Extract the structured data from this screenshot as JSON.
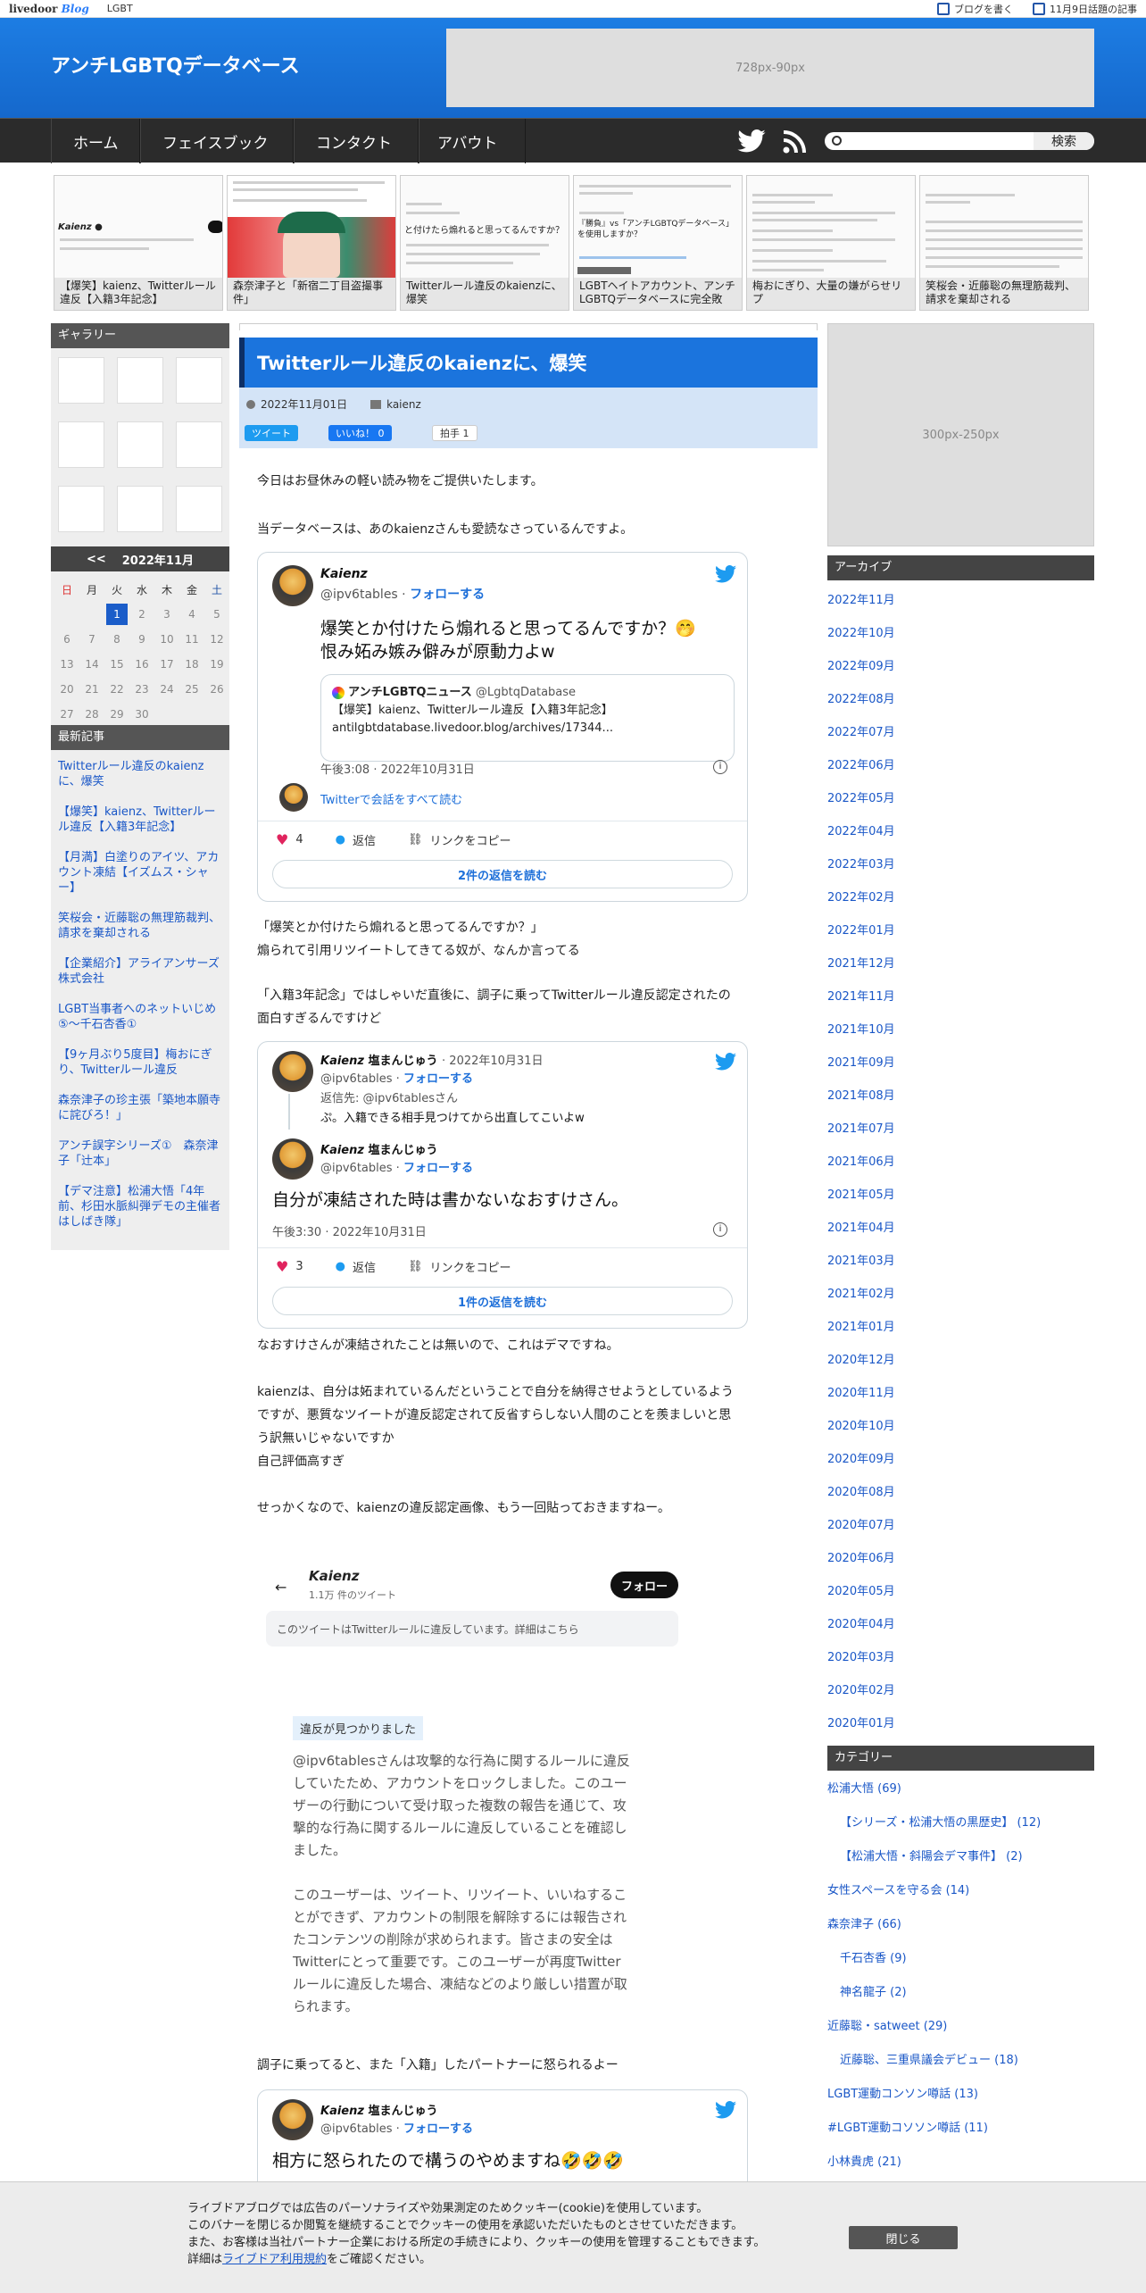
{
  "topbar": {
    "brand": "livedoor",
    "brand_sub": "Blog",
    "tag": "LGBT",
    "write": "ブログを書く",
    "trend": "11月9日話題の記事"
  },
  "header": {
    "title": "アンチLGBTQデータベース",
    "ad": "728px-90px"
  },
  "nav": {
    "items": [
      "ホーム",
      "フェイスブック",
      "コンタクト",
      "アバウト"
    ],
    "search_button": "検索"
  },
  "thumbs": [
    {
      "caption": "【爆笑】kaienz、Twitterルール違反【入籍3年記念】"
    },
    {
      "caption": "森奈津子と「新宿二丁目盗撮事件」"
    },
    {
      "caption": "Twitterルール違反のkaienzに、爆笑"
    },
    {
      "caption": "LGBTヘイトアカウント、アンチLGBTQデータベースに完全敗"
    },
    {
      "caption": "梅おにぎり、大量の嫌がらせリプ"
    },
    {
      "caption": "笑桜会・近藤聡の無理筋裁判、請求を棄却される"
    }
  ],
  "sidebar_left": {
    "gallery_title": "ギャラリー",
    "calendar": {
      "prev": "<<",
      "month": "2022年11月",
      "weekdays": [
        "日",
        "月",
        "火",
        "水",
        "木",
        "金",
        "土"
      ],
      "rows": [
        [
          "",
          "",
          "1",
          "2",
          "3",
          "4",
          "5"
        ],
        [
          "6",
          "7",
          "8",
          "9",
          "10",
          "11",
          "12"
        ],
        [
          "13",
          "14",
          "15",
          "16",
          "17",
          "18",
          "19"
        ],
        [
          "20",
          "21",
          "22",
          "23",
          "24",
          "25",
          "26"
        ],
        [
          "27",
          "28",
          "29",
          "30",
          "",
          "",
          ""
        ]
      ],
      "today": "1"
    },
    "recent_title": "最新記事",
    "recent": [
      "Twitterルール違反のkaienzに、爆笑",
      "【爆笑】kaienz、Twitterルール違反【入籍3年記念】",
      "【月満】白塗りのアイツ、アカウント凍結【イズムス・シャー】",
      "笑桜会・近藤聡の無理筋裁判、請求を棄却される",
      "【企業紹介】アライアンサーズ株式会社",
      "LGBT当事者へのネットいじめ⑤～千石杏香①",
      "【9ヶ月ぶり5度目】梅おにぎり、Twitterルール違反",
      "森奈津子の珍主張「築地本願寺に詫びろ！」",
      "アンチ誤字シリーズ①　森奈津子「辻本」",
      "【デマ注意】松浦大悟「4年前、杉田水脈糾弾デモの主催者はしばき隊」"
    ]
  },
  "post": {
    "title": "Twitterルール違反のkaienzに、爆笑",
    "date": "2022年11月01日",
    "category": "kaienz",
    "tweet_btn": "ツイート",
    "like_btn": "いいね！ 0",
    "clap_btn": "拍手 1",
    "p1": "今日はお昼休みの軽い読み物をご提供いたします。",
    "p2": "当データベースは、あのkaienzさんも愛読なさっているんですよ。",
    "tw1": {
      "name": "Kaienz",
      "handle": "@ipv6tables",
      "follow": "フォローする",
      "text1": "爆笑とか付けたら煽れると思ってるんですか？🤭",
      "text2": "恨み妬み嫉み僻みが原動力よw",
      "embed_name": "アンチLGBTQニュース",
      "embed_handle": "@LgbtqDatabase",
      "embed_l1": "【爆笑】kaienz、Twitterルール違反【入籍3年記念】",
      "embed_l2": "antilgbtdatabase.livedoor.blog/archives/17344...",
      "time": "午後3:08 · 2022年10月31日",
      "thread": "Twitterで会話をすべて読む",
      "likes": "4",
      "reply": "返信",
      "copy": "リンクをコピー",
      "replies_btn": "2件の返信を読む"
    },
    "p3a": "「爆笑とか付けたら煽れると思ってるんですか？」",
    "p3b": "煽られて引用リツイートしてきてる奴が、なんか言ってる",
    "p4a": "「入籍3年記念」ではしゃいだ直後に、調子に乗ってTwitterルール違反認定されたの",
    "p4b": "面白すぎるんですけど",
    "tw2": {
      "name1": "Kaienz",
      "user1": "塩まんじゅう",
      "date1": "· 2022年10月31日",
      "handle": "@ipv6tables",
      "follow": "フォローする",
      "reply_to": "返信先: @ipv6tablesさん",
      "text_small": "ぷ。入籍できる相手見つけてから出直してこいよw",
      "name2": "Kaienz",
      "user2": "塩まんじゅう",
      "text": "自分が凍結された時は書かないなおすけさん。",
      "time": "午後3:30 · 2022年10月31日",
      "likes": "3",
      "reply": "返信",
      "copy": "リンクをコピー",
      "replies_btn": "1件の返信を読む"
    },
    "p5": "なおすけさんが凍結されたことは無いので、これはデマですね。",
    "p6a": "kaienzは、自分は妬まれているんだということで自分を納得させようとしているよう",
    "p6b": "ですが、悪質なツイートが違反認定されて反省すらしない人間のことを羨ましいと思",
    "p6c": "う訳無いじゃないですか",
    "p6d": "自己評価高すぎ",
    "p7": "せっかくなので、kaienzの違反認定画像、もう一回貼っておきますねー。",
    "shot": {
      "name": "Kaienz",
      "count": "1.1万 件のツイート",
      "follow": "フォロー",
      "notice": "このツイートはTwitterルールに違反しています。詳細はこちら",
      "badge": "違反が見つかりました",
      "b1": [
        "@ipv6tablesさんは攻撃的な行為に関するルールに違反",
        "していたため、アカウントをロックしました。このユー",
        "ザーの行動について受け取った複数の報告を通じて、攻",
        "撃的な行為に関するルールに違反していることを確認し",
        "ました。"
      ],
      "b2": [
        "このユーザーは、ツイート、リツイート、いいねするこ",
        "とができず、アカウントの制限を解除するには報告され",
        "たコンテンツの削除が求められます。皆さまの安全は",
        "Twitterにとって重要です。このユーザーが再度Twitter",
        "ルールに違反した場合、凍結などのより厳しい措置が取",
        "られます。"
      ]
    },
    "p8": "調子に乗ってると、また「入籍」したパートナーに怒られるよー",
    "tw3": {
      "name": "Kaienz",
      "user": "塩まんじゅう",
      "handle": "@ipv6tables",
      "follow": "フォローする",
      "text": "相方に怒られたので構うのやめますね🤣🤣🤣"
    }
  },
  "sidebar_right": {
    "ad": "300px-250px",
    "archive_title": "アーカイブ",
    "archive": [
      "2022年11月",
      "2022年10月",
      "2022年09月",
      "2022年08月",
      "2022年07月",
      "2022年06月",
      "2022年05月",
      "2022年04月",
      "2022年03月",
      "2022年02月",
      "2022年01月",
      "2021年12月",
      "2021年11月",
      "2021年10月",
      "2021年09月",
      "2021年08月",
      "2021年07月",
      "2021年06月",
      "2021年05月",
      "2021年04月",
      "2021年03月",
      "2021年02月",
      "2021年01月",
      "2020年12月",
      "2020年11月",
      "2020年10月",
      "2020年09月",
      "2020年08月",
      "2020年07月",
      "2020年06月",
      "2020年05月",
      "2020年04月",
      "2020年03月",
      "2020年02月",
      "2020年01月"
    ],
    "category_title": "カテゴリー",
    "categories": [
      {
        "label": "松浦大悟 (69)",
        "indent": 0
      },
      {
        "label": "【シリーズ・松浦大悟の黒歴史】 (12)",
        "indent": 1
      },
      {
        "label": "【松浦大悟・斜陽会デマ事件】 (2)",
        "indent": 1
      },
      {
        "label": "女性スペースを守る会 (14)",
        "indent": 0
      },
      {
        "label": "森奈津子 (66)",
        "indent": 0
      },
      {
        "label": "千石杏香 (9)",
        "indent": 1
      },
      {
        "label": "神名龍子 (2)",
        "indent": 1
      },
      {
        "label": "近藤聡・satweet (29)",
        "indent": 0
      },
      {
        "label": "近藤聡、三重県議会デビュー (18)",
        "indent": 1
      },
      {
        "label": "LGBT運動コンソン噂話 (13)",
        "indent": 0
      },
      {
        "label": "#LGBT運動コソソン噂話 (11)",
        "indent": 0
      },
      {
        "label": "小林貴虎 (21)",
        "indent": 0
      }
    ]
  },
  "cookie": {
    "l1": "ライブドアブログでは広告のパーソナライズや効果測定のためクッキー(cookie)を使用しています。",
    "l2": "このバナーを閉じるか閲覧を継続することでクッキーの使用を承認いただいたものとさせていただきます。",
    "l3": "また、お客様は当社パートナー企業における所定の手続きにより、クッキーの使用を管理することもできます。",
    "l4a": "詳細は",
    "l4link": "ライブドア利用規約",
    "l4b": "をご確認ください。",
    "close": "閉じる"
  },
  "colors": {
    "header_blue": "#1b74dd",
    "nav_dark": "#2b2b2b",
    "link_blue": "#1a57c7",
    "today_blue": "#1b5dc9"
  }
}
